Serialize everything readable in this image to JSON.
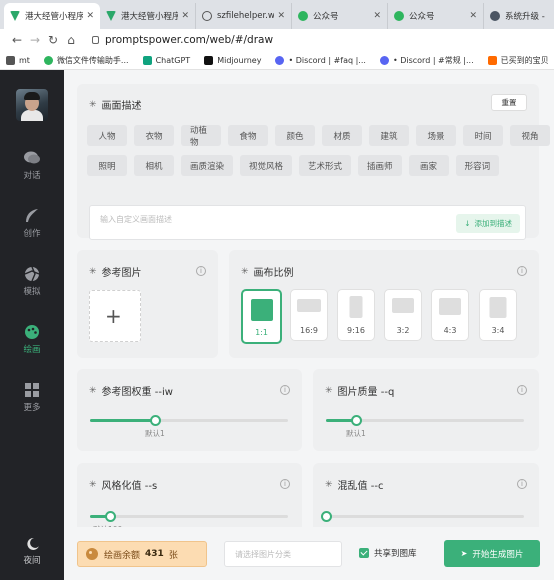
{
  "browser": {
    "tabs": [
      {
        "title": "港大经管小程序",
        "icon": "vue-icon",
        "active": true
      },
      {
        "title": "港大经管小程序",
        "icon": "vue-icon",
        "active": false
      },
      {
        "title": "szfilehelper.w",
        "icon": "sync-icon",
        "active": false
      },
      {
        "title": "公众号",
        "icon": "wechat-icon",
        "active": false
      },
      {
        "title": "公众号",
        "icon": "wechat-icon",
        "active": false
      },
      {
        "title": "系统升级 -",
        "icon": "globe-icon",
        "active": false
      }
    ],
    "url": "promptspower.com/web/#/draw",
    "bookmarks": [
      {
        "label": "mt",
        "color": "#555555"
      },
      {
        "label": "微信文件传输助手...",
        "color": "#2eb55e"
      },
      {
        "label": "ChatGPT",
        "color": "#10a37f"
      },
      {
        "label": "Midjourney",
        "color": "#111111"
      },
      {
        "label": "• Discord | #faq |...",
        "color": "#5865f2"
      },
      {
        "label": "• Discord | #常规 |...",
        "color": "#5865f2"
      },
      {
        "label": "已买到的宝贝",
        "color": "#ff6a00"
      }
    ]
  },
  "sidebar": {
    "items": [
      {
        "label": "对话",
        "icon": "chat-icon",
        "active": false
      },
      {
        "label": "创作",
        "icon": "feather-icon",
        "active": false
      },
      {
        "label": "模拟",
        "icon": "aperture-icon",
        "active": false
      },
      {
        "label": "绘画",
        "icon": "palette-icon",
        "active": true
      },
      {
        "label": "更多",
        "icon": "grid-icon",
        "active": false
      }
    ],
    "night_label": "夜间"
  },
  "description": {
    "title": "画面描述",
    "reset_label": "重置",
    "tags_row1": [
      "人物",
      "衣物",
      "动植物",
      "食物",
      "颜色",
      "材质",
      "建筑",
      "场景",
      "时间",
      "视角"
    ],
    "tags_row2": [
      "照明",
      "相机",
      "画质渲染",
      "视觉风格",
      "艺术形式",
      "插画师",
      "画家",
      "形容词"
    ],
    "input_placeholder": "输入自定义画面描述",
    "add_label": "添加到描述"
  },
  "reference": {
    "title": "参考图片",
    "upload_symbol": "+"
  },
  "ratio": {
    "title": "画布比例",
    "options": [
      "1:1",
      "16:9",
      "9:16",
      "3:2",
      "4:3",
      "3:4"
    ],
    "selected": "1:1"
  },
  "sliders": {
    "iw": {
      "title": "参考图权重 --iw",
      "default_label": "默认1",
      "value_fraction": 0.33
    },
    "quality": {
      "title": "图片质量 --q",
      "default_label": "默认1",
      "value_fraction": 0.15
    },
    "stylize": {
      "title": "风格化值 --s",
      "default_label": "默认100",
      "value_fraction": 0.1
    },
    "chaos": {
      "title": "混乱值 --c",
      "default_label": "",
      "value_fraction": 0.0
    }
  },
  "footer": {
    "balance_label": "绘画余额",
    "balance_value": "431",
    "balance_unit": "张",
    "category_placeholder": "请选择图片分类",
    "share_label": "共享到图库",
    "share_checked": true,
    "generate_label": "开始生成图片"
  }
}
